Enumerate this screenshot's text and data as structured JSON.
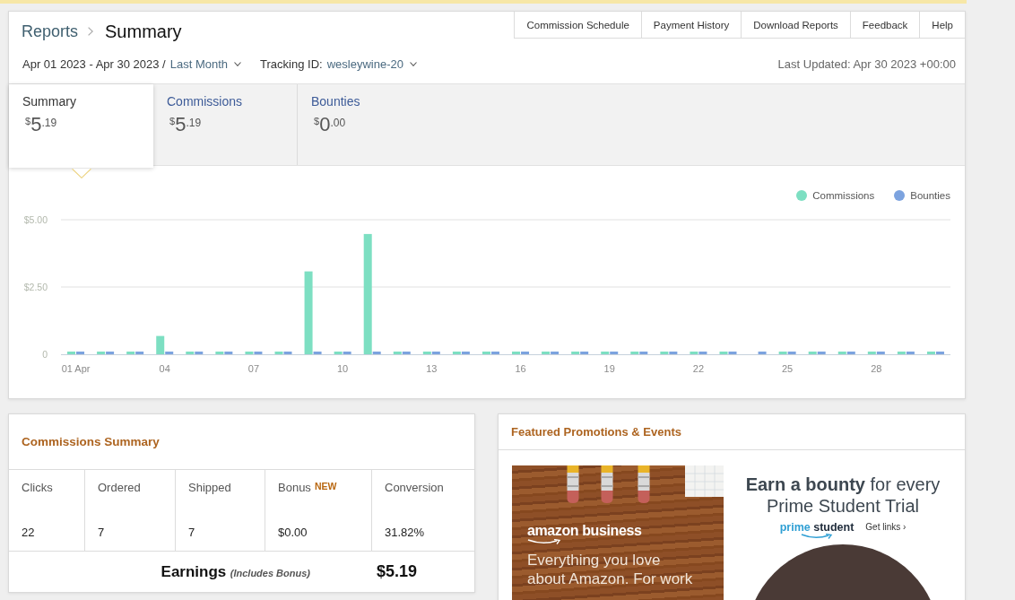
{
  "breadcrumb": {
    "parent": "Reports",
    "current": "Summary"
  },
  "nav_links": [
    "Commission Schedule",
    "Payment History",
    "Download Reports",
    "Feedback",
    "Help"
  ],
  "filters": {
    "date_range": "Apr 01 2023 - Apr 30 2023 /",
    "period": "Last Month",
    "tracking_label": "Tracking ID:",
    "tracking_id": "wesleywine-20"
  },
  "last_updated": "Last Updated: Apr 30 2023 +00:00",
  "summary_tabs": [
    {
      "label": "Summary",
      "currency": "$",
      "whole": "5",
      "cents": ".19",
      "selected": true
    },
    {
      "label": "Commissions",
      "currency": "$",
      "whole": "5",
      "cents": ".19",
      "selected": false
    },
    {
      "label": "Bounties",
      "currency": "$",
      "whole": "0",
      "cents": ".00",
      "selected": false
    }
  ],
  "chart": {
    "chart_data": {
      "type": "bar",
      "x": [
        1,
        2,
        3,
        4,
        5,
        6,
        7,
        8,
        9,
        10,
        11,
        12,
        13,
        14,
        15,
        16,
        17,
        18,
        19,
        20,
        21,
        22,
        23,
        24,
        25,
        26,
        27,
        28,
        29,
        30
      ],
      "series": [
        {
          "name": "Commissions",
          "color": "#7ddfc2",
          "values": [
            0,
            0,
            0,
            0.68,
            0,
            0,
            0,
            0,
            3.08,
            0,
            4.47,
            0,
            0,
            0,
            0,
            0,
            0,
            0,
            0,
            0,
            0,
            0,
            0,
            null,
            0,
            0,
            0,
            0,
            0,
            0
          ]
        },
        {
          "name": "Bounties",
          "color": "#7ca3df",
          "values": [
            0,
            0,
            0,
            0,
            0,
            0,
            0,
            0,
            0,
            0,
            0,
            0,
            0,
            0,
            0,
            0,
            0,
            0,
            0,
            0,
            0,
            0,
            0,
            0,
            0,
            0,
            0,
            0,
            0,
            0
          ]
        }
      ],
      "xlim": [
        0.5,
        30.5
      ],
      "ylim": [
        0,
        5
      ],
      "yticks": [
        0,
        {
          "value": 2.5,
          "label": "$2.50"
        },
        {
          "value": 5,
          "label": "$5.00"
        }
      ],
      "xticks": [
        {
          "value": 1,
          "label": "01 Apr"
        },
        {
          "value": 4,
          "label": "04"
        },
        {
          "value": 7,
          "label": "07"
        },
        {
          "value": 10,
          "label": "10"
        },
        {
          "value": 13,
          "label": "13"
        },
        {
          "value": 16,
          "label": "16"
        },
        {
          "value": 19,
          "label": "19"
        },
        {
          "value": 22,
          "label": "22"
        },
        {
          "value": 25,
          "label": "25"
        },
        {
          "value": 28,
          "label": "28"
        }
      ]
    }
  },
  "commissions_summary": {
    "title": "Commissions Summary",
    "columns": [
      {
        "label": "Clicks",
        "value": "22"
      },
      {
        "label": "Ordered",
        "value": "7"
      },
      {
        "label": "Shipped",
        "value": "7"
      },
      {
        "label": "Bonus",
        "badge": "NEW",
        "value": "$0.00"
      },
      {
        "label": "Conversion",
        "value": "31.82%"
      }
    ],
    "earnings_label": "**Earnings** *(Includes Bonus)*",
    "earnings_value": "$5.19"
  },
  "promotions": {
    "title": "Featured Promotions & Events",
    "banners": [
      {
        "kind": "business",
        "brand": "amazon business",
        "tagline_lines": [
          "Everything you love",
          "about Amazon. For work"
        ]
      },
      {
        "kind": "student",
        "headline_lines": [
          "**Earn a bounty** for every",
          "Prime Student Trial"
        ],
        "brand_accent": "prime",
        "brand": "student",
        "link": "Get links ›"
      }
    ]
  }
}
